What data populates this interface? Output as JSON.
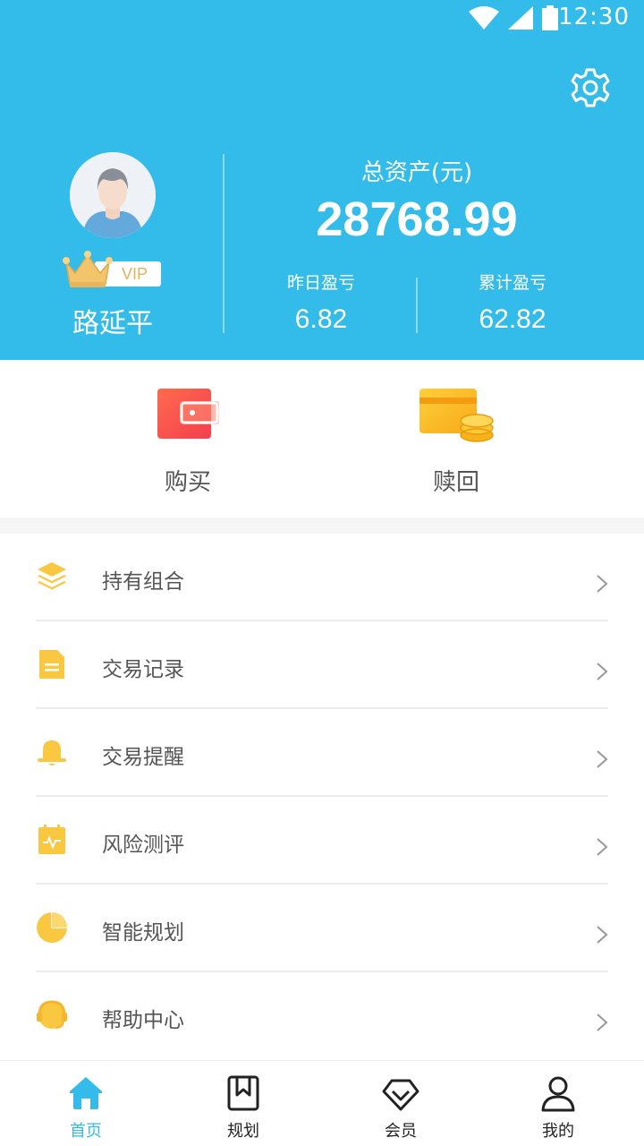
{
  "status_bar": {
    "time": "12:30"
  },
  "profile": {
    "name": "路延平",
    "badge": "VIP"
  },
  "assets": {
    "total_label": "总资产(元)",
    "total_value": "28768.99",
    "yesterday_label": "昨日盈亏",
    "yesterday_value": "6.82",
    "cumulative_label": "累计盈亏",
    "cumulative_value": "62.82"
  },
  "actions": [
    {
      "label": "购买",
      "icon": "wallet-icon"
    },
    {
      "label": "赎回",
      "icon": "card-coins-icon"
    }
  ],
  "menu": [
    {
      "label": "持有组合",
      "icon": "layers-icon"
    },
    {
      "label": "交易记录",
      "icon": "document-icon"
    },
    {
      "label": "交易提醒",
      "icon": "bell-icon"
    },
    {
      "label": "风险测评",
      "icon": "calendar-pulse-icon"
    },
    {
      "label": "智能规划",
      "icon": "pie-chart-icon"
    },
    {
      "label": "帮助中心",
      "icon": "headset-icon"
    }
  ],
  "tabbar": [
    {
      "label": "首页",
      "icon": "home-icon",
      "active": true
    },
    {
      "label": "规划",
      "icon": "bookmark-book-icon"
    },
    {
      "label": "会员",
      "icon": "diamond-icon"
    },
    {
      "label": "我的",
      "icon": "person-icon"
    }
  ],
  "colors": {
    "header": "#33bbe9",
    "icon_yellow": "#f9c740",
    "buy_red": "#f8564e",
    "vip_gold": "#e0b45a"
  }
}
